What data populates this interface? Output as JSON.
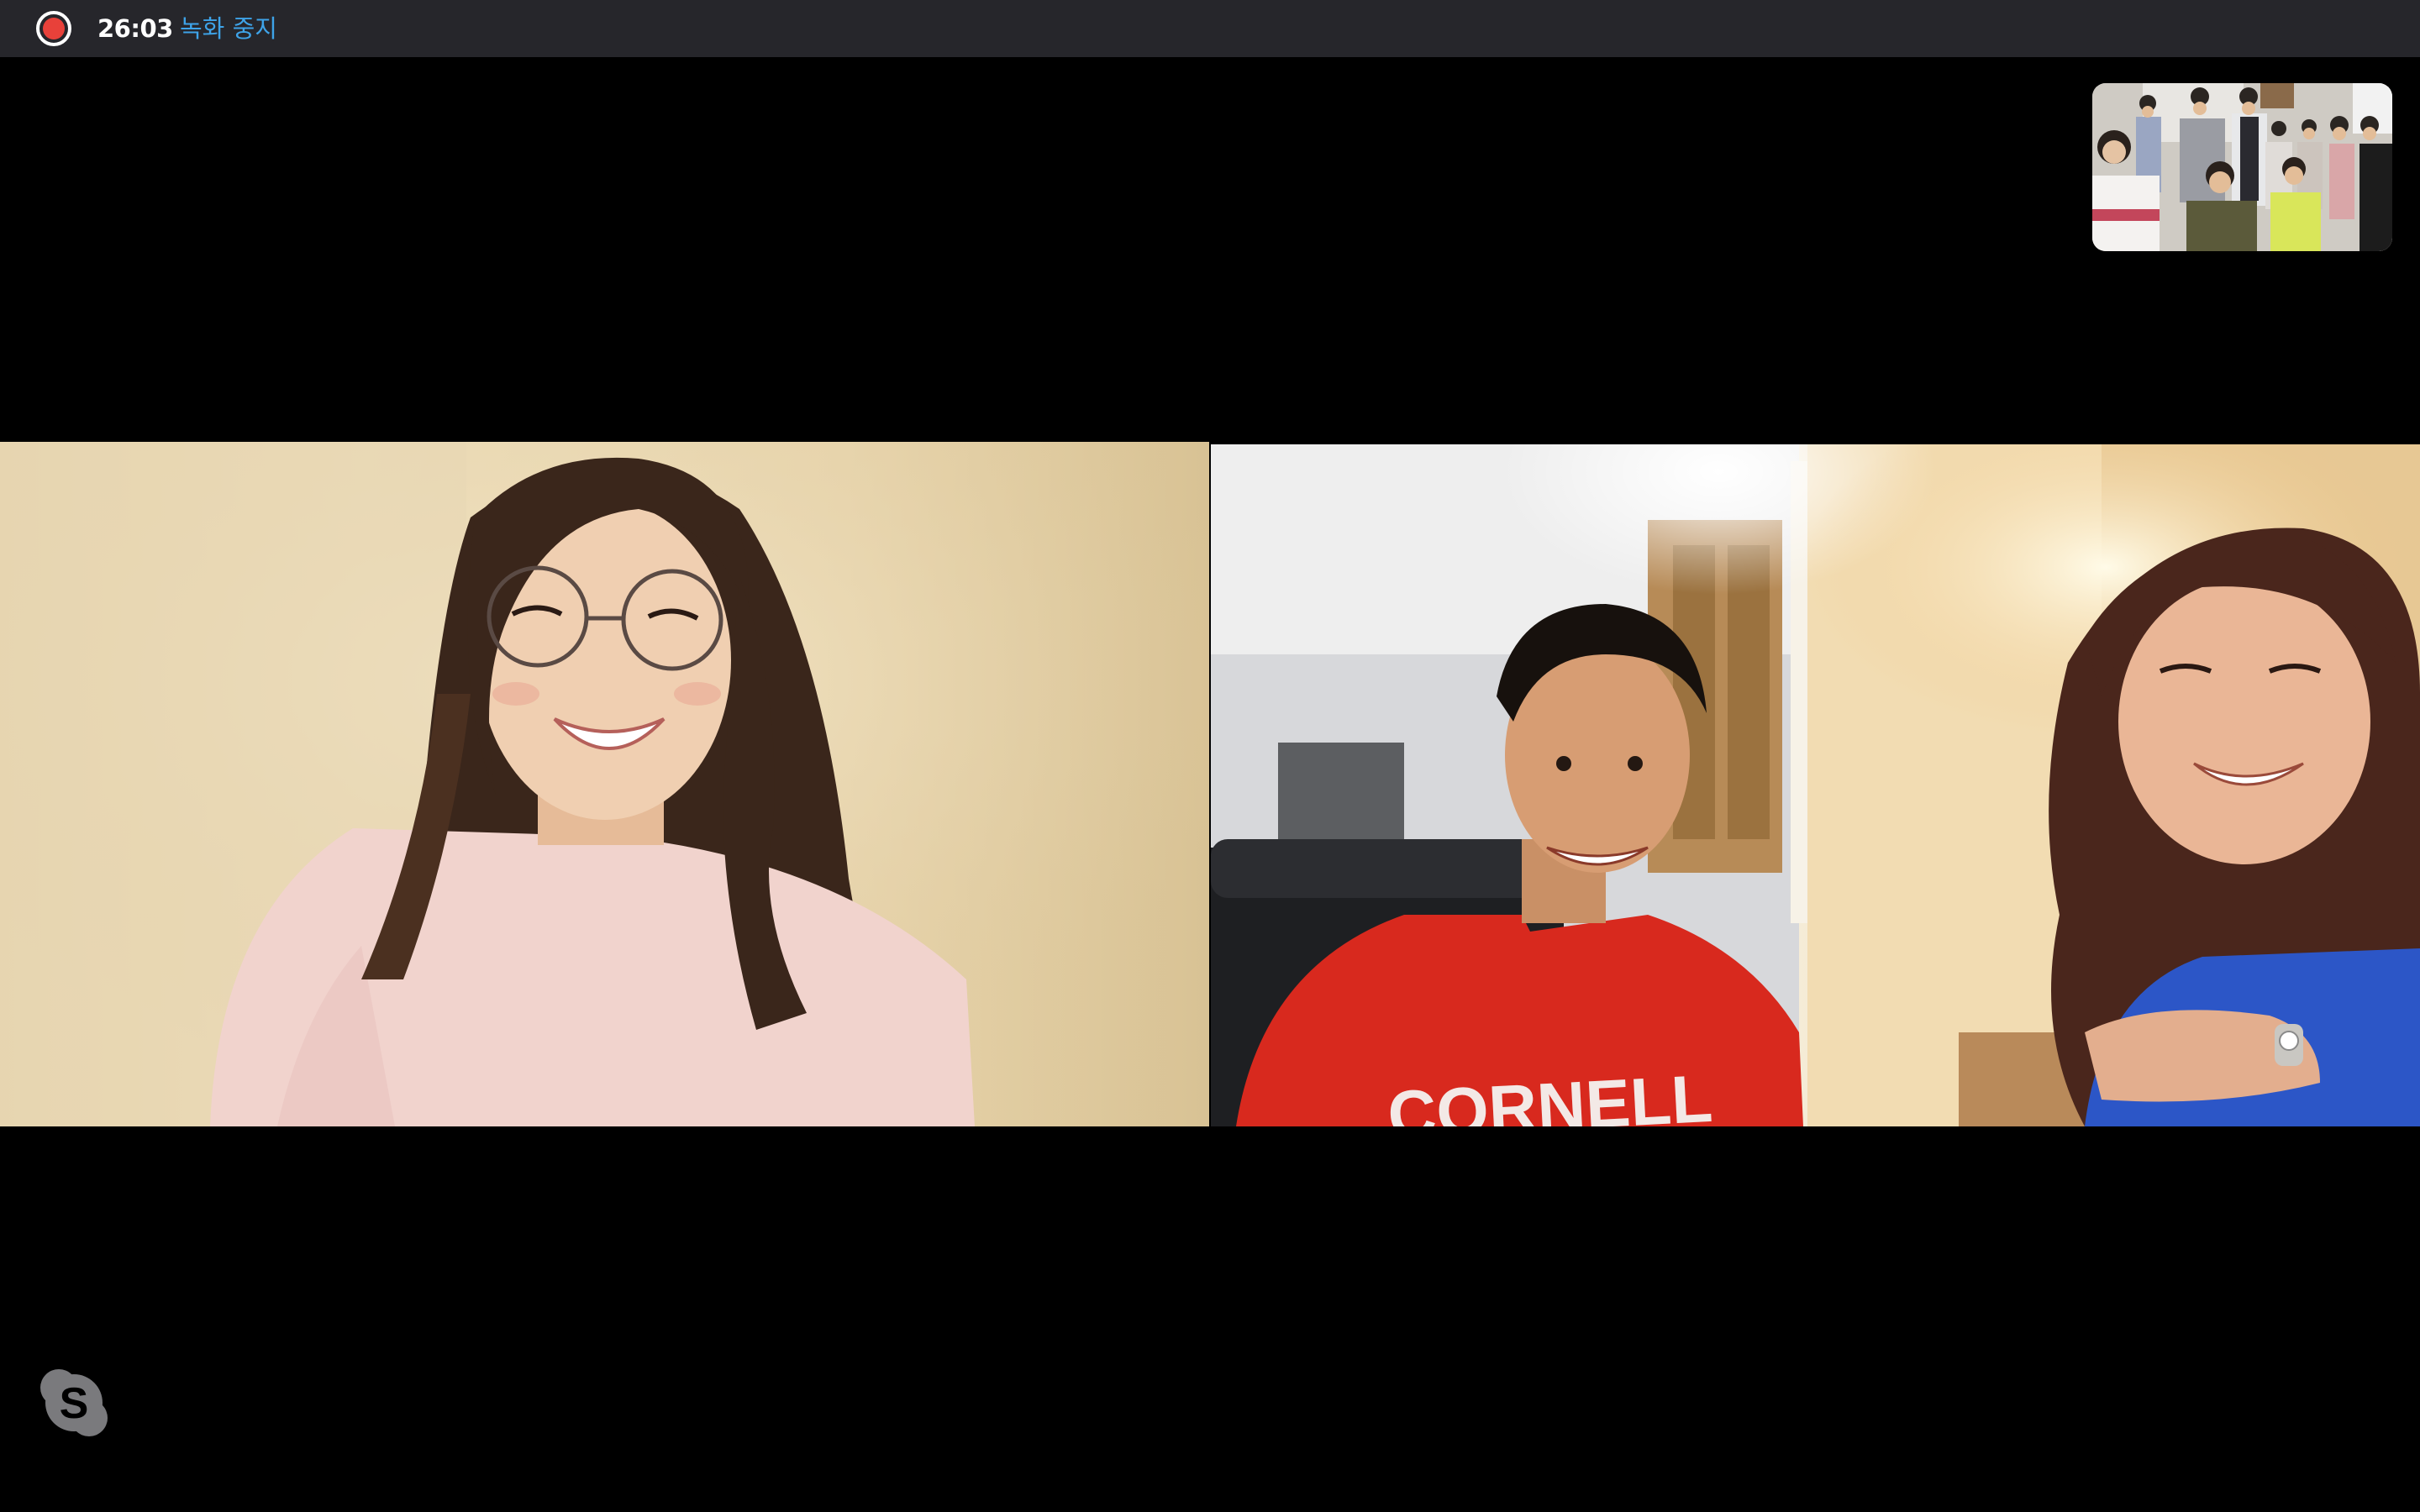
{
  "recording": {
    "time": "26:03",
    "stop_label": "녹화 중지",
    "indicator_color": "#e8413a"
  },
  "participants": [
    {
      "tile": "left",
      "description_icon": "video-feed"
    },
    {
      "tile": "right",
      "description_icon": "video-feed",
      "shirt_text": "CORNELL"
    }
  ],
  "self_preview": {
    "icon": "video-feed"
  },
  "app_icon": "skype-icon",
  "colors": {
    "topbar": "#26262b",
    "link": "#3ea3e8",
    "background": "#000000"
  }
}
